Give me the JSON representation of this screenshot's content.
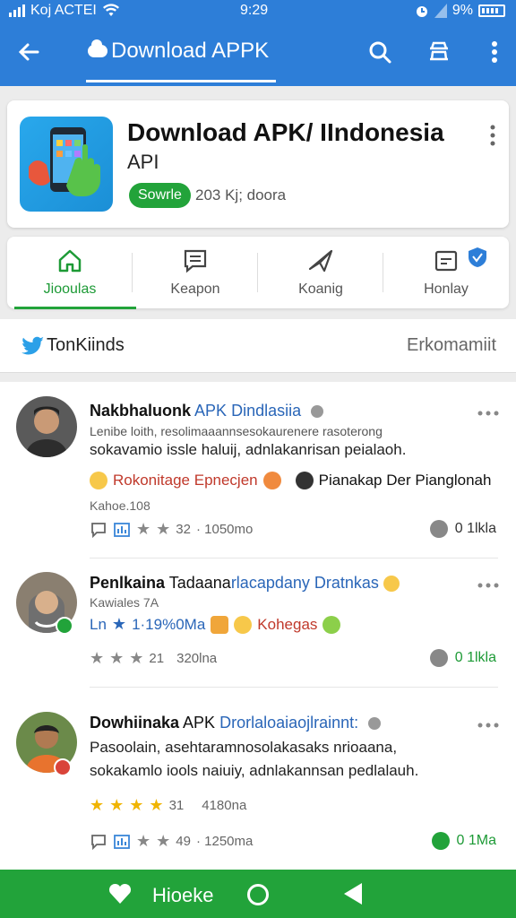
{
  "status_bar": {
    "carrier": "Koj ACTEI",
    "time": "9:29",
    "battery": "9%"
  },
  "app_bar": {
    "title": "Download APPK"
  },
  "app": {
    "name": "Download APK/ IIndonesia",
    "subtitle": "API",
    "source_badge": "Sowrle",
    "size_text": "203 Kj; doora"
  },
  "tabs": [
    {
      "label": "Jiooulas"
    },
    {
      "label": "Keapon"
    },
    {
      "label": "Koanig"
    },
    {
      "label": "Honlay"
    }
  ],
  "section": {
    "title": "TonKiinds",
    "right_label": "Erkomamiit"
  },
  "posts": [
    {
      "author": "Nakbhaluonk",
      "channel": "APK Dindlasiia",
      "line1": "Lenibe loith, resolimaaannsesokaurenere rasoterong",
      "line2": "sokavamio issle haluij, adnlakanrisan peialaoh.",
      "tag1": "Rokonitage Epnecjen",
      "tag2": "Pianakap Der Pianglonah",
      "meta": "Kahoe.108",
      "rating_count": "32",
      "views": "· 1050mo",
      "right_count": "0 1lkla"
    },
    {
      "author": "Penlkaina",
      "channel_plain": "Tadaana",
      "channel": "rlacapdany Dratnkas",
      "meta": "Kawiales 7A",
      "tag_prefix": "Ln",
      "tag1": "1·19%0Ma",
      "tag2": "Kohegas",
      "rating_count": "21",
      "views": "320lna",
      "right_count": "0 1lkla"
    },
    {
      "author": "Dowhiinaka",
      "channel_plain": "APK",
      "channel": "Drorlaloaiaojlrainnt:",
      "line1": "Pasoolain, asehtaramnosolakasaks nrioaana,",
      "line2": "sokakamlo iools naiuiy, adnlakannsan pedlalauh.",
      "rating_count": "31",
      "rating_count2": "49",
      "views": "4180na",
      "views2": "· 1250ma",
      "right_count": "0 1Ma"
    }
  ],
  "bottom_bar": {
    "label": "Hioeke"
  },
  "colors": {
    "primary_blue": "#2d7ed8",
    "accent_green": "#22a33a",
    "star_gold": "#f0b400"
  }
}
